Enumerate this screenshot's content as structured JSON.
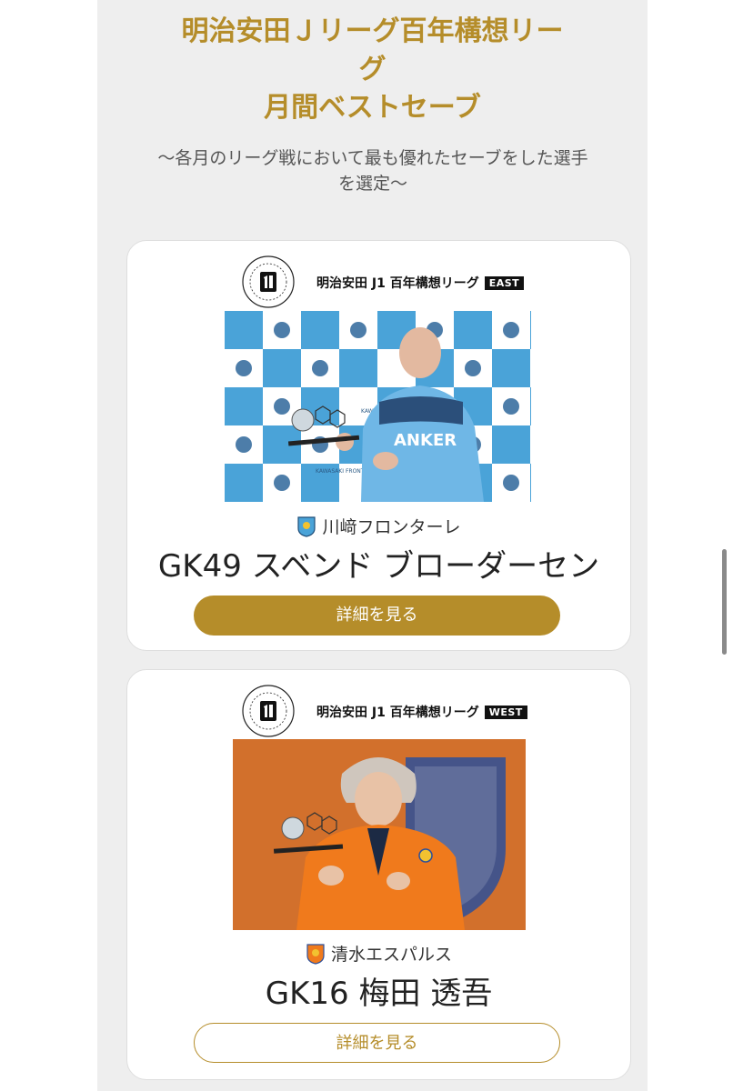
{
  "header": {
    "title_line1": "明治安田Ｊリーグ百年構想リー",
    "title_line2": "グ",
    "title_line3": "月間ベストセーブ",
    "subtitle_line1": "〜各月のリーグ戦において最も優れたセーブをした選手",
    "subtitle_line2": "を選定〜"
  },
  "cards": [
    {
      "league_name": "明治安田 J1 百年構想リーグ",
      "region": "EAST",
      "club": "川﨑フロンターレ",
      "player": "GK49 スベンド ブローダーセン",
      "button_label": "詳細を見る",
      "backdrop_text": "KAWASAKI FRONTALE",
      "shirt_text": "ANKER"
    },
    {
      "league_name": "明治安田 J1 百年構想リーグ",
      "region": "WEST",
      "club": "清水エスパルス",
      "player": "GK16 梅田 透吾",
      "button_label": "詳細を見る"
    }
  ],
  "colors": {
    "accent_gold": "#b58d2a",
    "panel_bg": "#eeeeee"
  }
}
